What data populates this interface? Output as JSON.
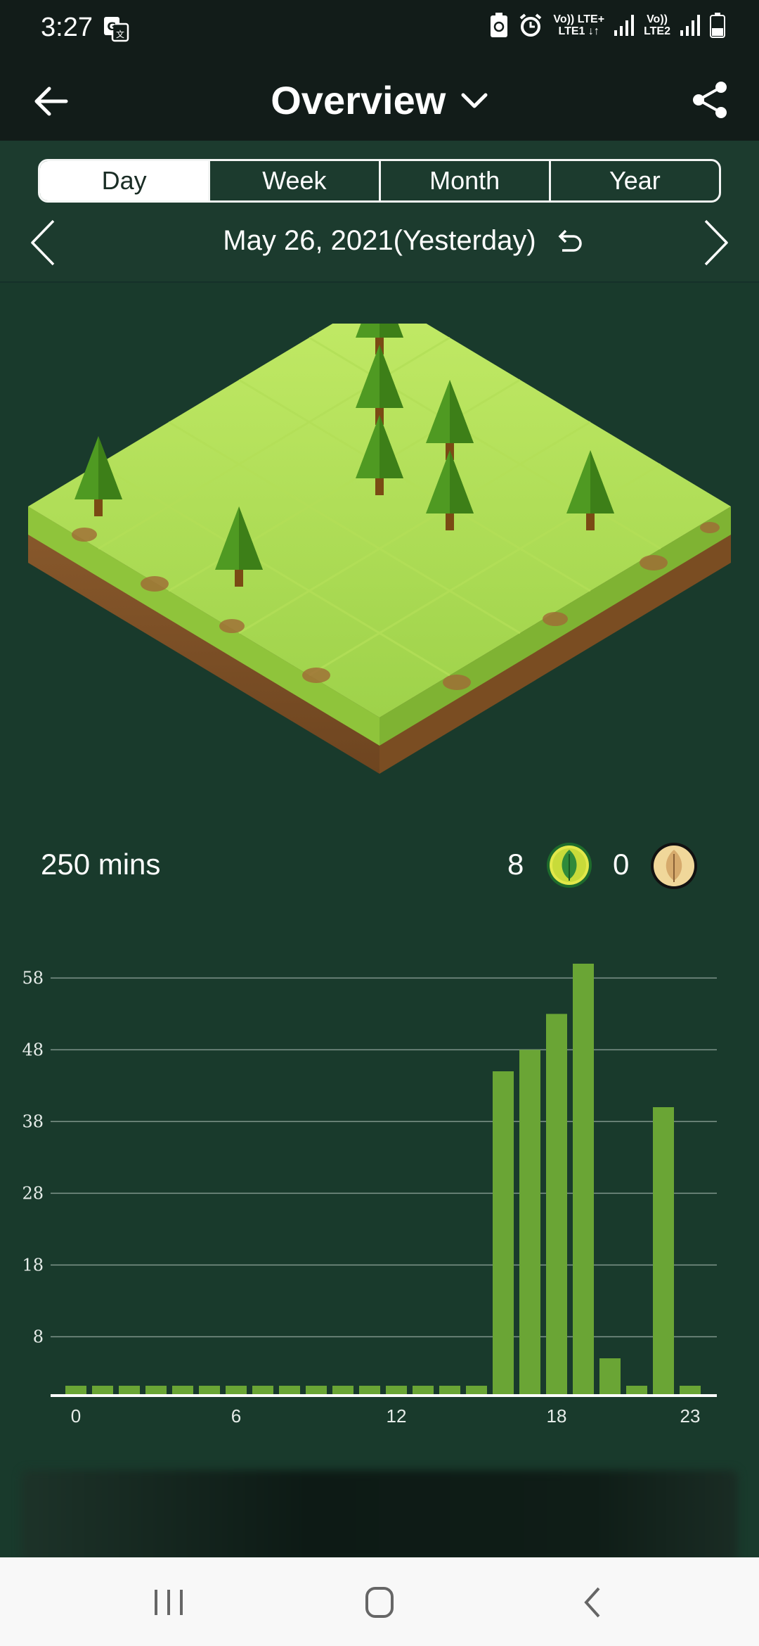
{
  "status": {
    "time": "3:27",
    "sim1_top": "Vo)) LTE+",
    "sim1_bottom": "LTE1 ↓↑",
    "sim2_top": "Vo))",
    "sim2_bottom": "LTE2"
  },
  "appbar": {
    "title": "Overview"
  },
  "tabs": [
    {
      "label": "Day",
      "active": true
    },
    {
      "label": "Week",
      "active": false
    },
    {
      "label": "Month",
      "active": false
    },
    {
      "label": "Year",
      "active": false
    }
  ],
  "date": {
    "label": "May 26, 2021(Yesterday)"
  },
  "stats": {
    "minutes": "250 mins",
    "trees": "8",
    "dead_trees": "0"
  },
  "colors": {
    "background": "#193a2c",
    "bar": "#6aa535",
    "grass": "#a6d94a",
    "soil": "#8b5a2b"
  },
  "chart_data": {
    "type": "bar",
    "categories": [
      0,
      1,
      2,
      3,
      4,
      5,
      6,
      7,
      8,
      9,
      10,
      11,
      12,
      13,
      14,
      15,
      16,
      17,
      18,
      19,
      20,
      21,
      22,
      23
    ],
    "x_tick_labels": [
      "0",
      "6",
      "12",
      "18",
      "23"
    ],
    "values": [
      0,
      0,
      0,
      0,
      0,
      0,
      0,
      0,
      0,
      0,
      0,
      0,
      0,
      0,
      0,
      0,
      45,
      48,
      53,
      60,
      5,
      0,
      40,
      0
    ],
    "ylim": [
      0,
      60
    ],
    "y_ticks": [
      8,
      18,
      28,
      38,
      48,
      58
    ],
    "grid": true
  }
}
